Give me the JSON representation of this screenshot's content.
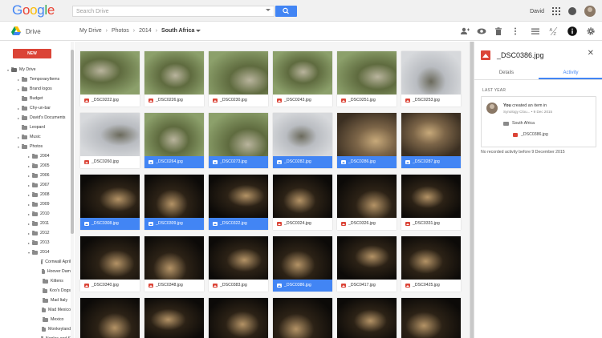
{
  "app": {
    "logo_text": "Google",
    "logo_colors": [
      "#4285f4",
      "#ea4335",
      "#fbbc05",
      "#4285f4",
      "#34a853",
      "#ea4335"
    ],
    "search_placeholder": "Search Drive",
    "user_name": "David"
  },
  "subbar": {
    "drive_label": "Drive",
    "breadcrumbs": [
      "My Drive",
      "Photos",
      "2014",
      "South Africa"
    ]
  },
  "sidebar": {
    "new_label": "NEW",
    "tree": [
      {
        "label": "My Drive",
        "depth": 0,
        "arrow": "▾"
      },
      {
        "label": "TemporaryItems",
        "depth": 1,
        "arrow": "▸"
      },
      {
        "label": "Brand logos",
        "depth": 1,
        "arrow": "▸"
      },
      {
        "label": "Budget",
        "depth": 1,
        "arrow": ""
      },
      {
        "label": "Chy-un-bar",
        "depth": 1,
        "arrow": "▸"
      },
      {
        "label": "David's Documents",
        "depth": 1,
        "arrow": "▸"
      },
      {
        "label": "Leopard",
        "depth": 1,
        "arrow": ""
      },
      {
        "label": "Music",
        "depth": 1,
        "arrow": "▸"
      },
      {
        "label": "Photos",
        "depth": 1,
        "arrow": "▾"
      },
      {
        "label": "2004",
        "depth": 2,
        "arrow": "▸"
      },
      {
        "label": "2005",
        "depth": 2,
        "arrow": "▸"
      },
      {
        "label": "2006",
        "depth": 2,
        "arrow": "▸"
      },
      {
        "label": "2007",
        "depth": 2,
        "arrow": "▸"
      },
      {
        "label": "2008",
        "depth": 2,
        "arrow": "▸"
      },
      {
        "label": "2009",
        "depth": 2,
        "arrow": "▸"
      },
      {
        "label": "2010",
        "depth": 2,
        "arrow": "▸"
      },
      {
        "label": "2011",
        "depth": 2,
        "arrow": "▸"
      },
      {
        "label": "2012",
        "depth": 2,
        "arrow": "▸"
      },
      {
        "label": "2013",
        "depth": 2,
        "arrow": "▸"
      },
      {
        "label": "2014",
        "depth": 2,
        "arrow": "▾"
      },
      {
        "label": "Cornwall April",
        "depth": 3,
        "arrow": ""
      },
      {
        "label": "Hoover Dam",
        "depth": 3,
        "arrow": ""
      },
      {
        "label": "Kittens",
        "depth": 3,
        "arrow": ""
      },
      {
        "label": "Koo's Dogs",
        "depth": 3,
        "arrow": ""
      },
      {
        "label": "Mad Italy",
        "depth": 3,
        "arrow": ""
      },
      {
        "label": "Mad Mexico",
        "depth": 3,
        "arrow": ""
      },
      {
        "label": "Mexico",
        "depth": 3,
        "arrow": ""
      },
      {
        "label": "Monkeyland",
        "depth": 3,
        "arrow": ""
      },
      {
        "label": "Naples and S",
        "depth": 3,
        "arrow": ""
      }
    ]
  },
  "files": [
    {
      "name": "_DSC0222.jpg",
      "selected": false,
      "scene": "day"
    },
    {
      "name": "_DSC0226.jpg",
      "selected": false,
      "scene": "day"
    },
    {
      "name": "_DSC0230.jpg",
      "selected": false,
      "scene": "day"
    },
    {
      "name": "_DSC0243.jpg",
      "selected": false,
      "scene": "day"
    },
    {
      "name": "_DSC0251.jpg",
      "selected": false,
      "scene": "day"
    },
    {
      "name": "_DSC0253.jpg",
      "selected": false,
      "scene": "sky"
    },
    {
      "name": "_DSC0260.jpg",
      "selected": false,
      "scene": "sky"
    },
    {
      "name": "_DSC0264.jpg",
      "selected": true,
      "scene": "day"
    },
    {
      "name": "_DSC0273.jpg",
      "selected": true,
      "scene": "day"
    },
    {
      "name": "_DSC0282.jpg",
      "selected": true,
      "scene": "sky"
    },
    {
      "name": "_DSC0286.jpg",
      "selected": true,
      "scene": "dusk"
    },
    {
      "name": "_DSC0287.jpg",
      "selected": true,
      "scene": "dusk"
    },
    {
      "name": "_DSC0308.jpg",
      "selected": true,
      "scene": "night"
    },
    {
      "name": "_DSC0309.jpg",
      "selected": true,
      "scene": "night"
    },
    {
      "name": "_DSC0322.jpg",
      "selected": true,
      "scene": "night"
    },
    {
      "name": "_DSC0324.jpg",
      "selected": false,
      "scene": "night"
    },
    {
      "name": "_DSC0326.jpg",
      "selected": false,
      "scene": "night"
    },
    {
      "name": "_DSC0331.jpg",
      "selected": false,
      "scene": "night"
    },
    {
      "name": "_DSC0340.jpg",
      "selected": false,
      "scene": "night"
    },
    {
      "name": "_DSC0348.jpg",
      "selected": false,
      "scene": "night"
    },
    {
      "name": "_DSC0383.jpg",
      "selected": false,
      "scene": "night"
    },
    {
      "name": "_DSC0386.jpg",
      "selected": true,
      "scene": "night"
    },
    {
      "name": "_DSC0417.jpg",
      "selected": false,
      "scene": "night"
    },
    {
      "name": "_DSC0425.jpg",
      "selected": false,
      "scene": "night"
    },
    {
      "name": "",
      "selected": false,
      "scene": "night"
    },
    {
      "name": "",
      "selected": false,
      "scene": "night"
    },
    {
      "name": "",
      "selected": false,
      "scene": "night"
    },
    {
      "name": "",
      "selected": false,
      "scene": "night"
    },
    {
      "name": "",
      "selected": false,
      "scene": "night"
    },
    {
      "name": "",
      "selected": false,
      "scene": "night"
    }
  ],
  "panel": {
    "title": "_DSC0386.jpg",
    "tab_details": "Details",
    "tab_activity": "Activity",
    "section": "LAST YEAR",
    "activity": {
      "actor": "You",
      "action": " created an item in",
      "meta": "Synology Clou... • 9 Dec 2015",
      "folder": "South Africa",
      "file": "_DSC0386.jpg"
    },
    "no_records": "No recorded activity before 9 December 2015"
  },
  "colors": {
    "accent": "#4285f4",
    "new_button": "#db4437",
    "image_icon": "#db4437"
  }
}
